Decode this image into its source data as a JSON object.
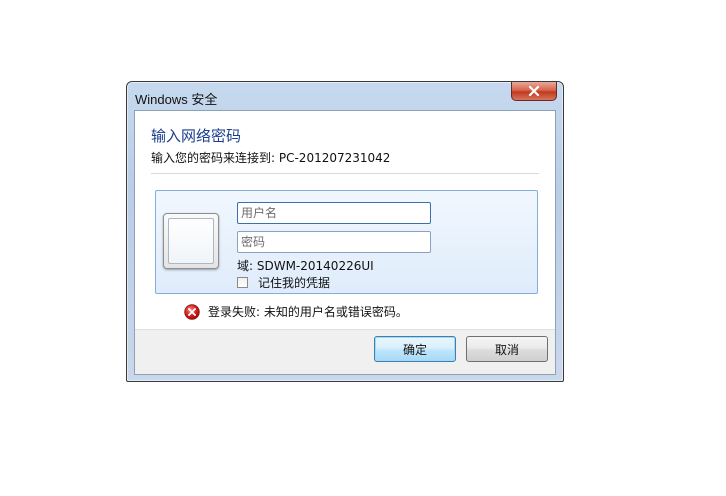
{
  "window": {
    "title": "Windows 安全"
  },
  "dialog": {
    "heading": "输入网络密码",
    "subheading": "输入您的密码来连接到: PC-201207231042"
  },
  "credentials": {
    "username_placeholder": "用户名",
    "username_value": "",
    "password_placeholder": "密码",
    "password_value": "",
    "domain_text": "域: SDWM-20140226UI",
    "remember_label": "记住我的凭据",
    "remember_checked": false
  },
  "error": {
    "message": "登录失败: 未知的用户名或错误密码。"
  },
  "buttons": {
    "ok_label": "确定",
    "cancel_label": "取消"
  },
  "icons": {
    "close": "close-icon",
    "error": "error-icon",
    "user_tile": "user-tile-icon"
  },
  "colors": {
    "heading": "#1a3e8f",
    "close_button": "#c2391e",
    "error_red": "#d32020",
    "tile_border": "#84acdd"
  }
}
